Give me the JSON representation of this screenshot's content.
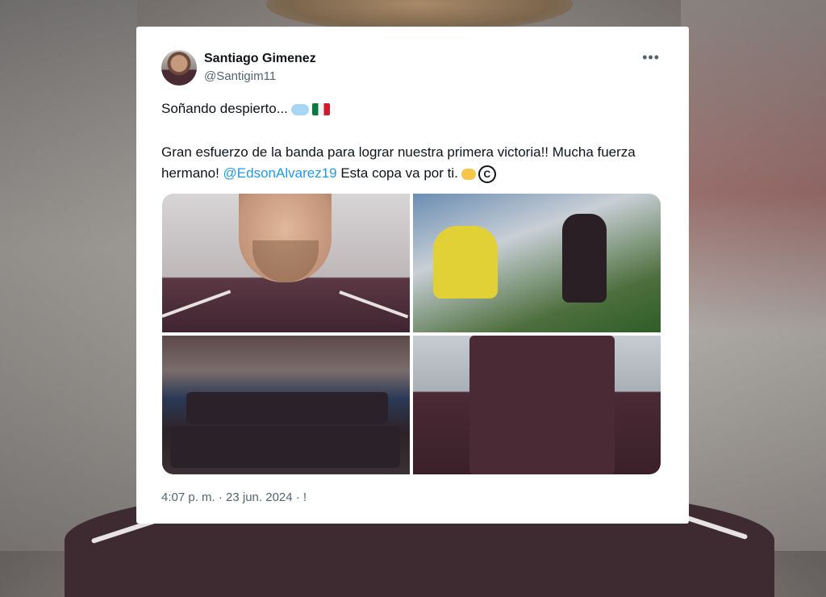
{
  "tweet": {
    "author_name": "Santiago Gimenez",
    "author_handle": "@Santigim11",
    "more_icon": "more-horizontal-icon",
    "line1": "Soñando despierto...",
    "body_part1": "Gran esfuerzo de la banda para lograr nuestra primera victoria!! Mucha fuerza hermano! ",
    "mention": "@EdsonAlvarez19",
    "body_part2": " Esta copa va por ti.",
    "timestamp": "4:07 p. m. · 23 jun. 2024 · !",
    "emojis": [
      "thought-bubble-icon",
      "mexico-flag-icon",
      "handshake-icon",
      "copyright-icon"
    ]
  },
  "media": {
    "photos": [
      {
        "name": "photo-player-closeup"
      },
      {
        "name": "photo-match-action"
      },
      {
        "name": "photo-team-lineup"
      },
      {
        "name": "photo-players-walking"
      }
    ]
  },
  "colors": {
    "accent": "#1d9bf0",
    "text_primary": "#0f1419",
    "text_secondary": "#536471",
    "card_bg": "#ffffff"
  }
}
